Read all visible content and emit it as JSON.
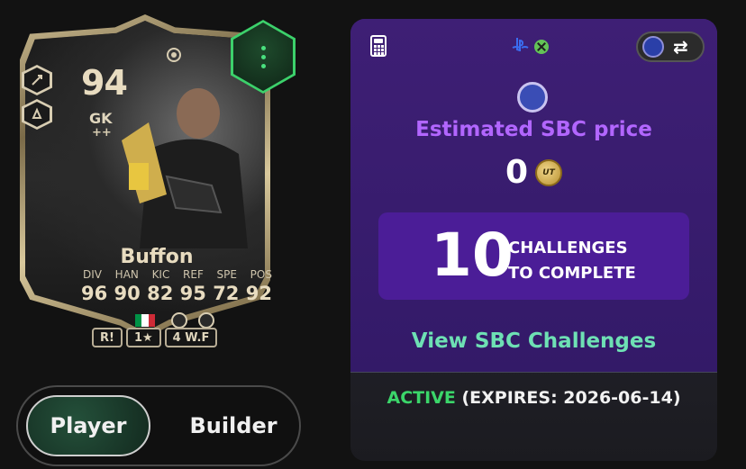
{
  "card": {
    "rating": "94",
    "position": "GK",
    "plus": "++",
    "name": "Buffon",
    "stat_labels": [
      "DIV",
      "HAN",
      "KIC",
      "REF",
      "SPE",
      "POS"
    ],
    "stat_values": [
      "96",
      "90",
      "82",
      "95",
      "72",
      "92"
    ],
    "nation_flag_colors": [
      "#009246",
      "#ffffff",
      "#ce2b37"
    ],
    "footer": {
      "skill_label": "R!",
      "weak_label": "1★",
      "wf_label": "4 W.F"
    },
    "options_icon": "more-vertical-icon"
  },
  "toggle": {
    "player_label": "Player",
    "builder_label": "Builder"
  },
  "panel": {
    "calculator_icon": "calculator-icon",
    "platforms": [
      "playstation-icon",
      "xbox-icon"
    ],
    "swap_icon": "swap-icon",
    "title": "Estimated SBC price",
    "price": "0",
    "coin_label": "UT",
    "challenge_count": "10",
    "challenge_line1": "CHALLENGES",
    "challenge_line2": "TO COMPLETE",
    "view_link": "View SBC Challenges",
    "status_active": "ACTIVE",
    "status_expiry": " (EXPIRES: 2026-06-14)"
  },
  "colors": {
    "accent_purple": "#b266ff",
    "active_green": "#3bd66a",
    "link_teal": "#6ee0b4",
    "hex_green": "#3cd16b"
  }
}
